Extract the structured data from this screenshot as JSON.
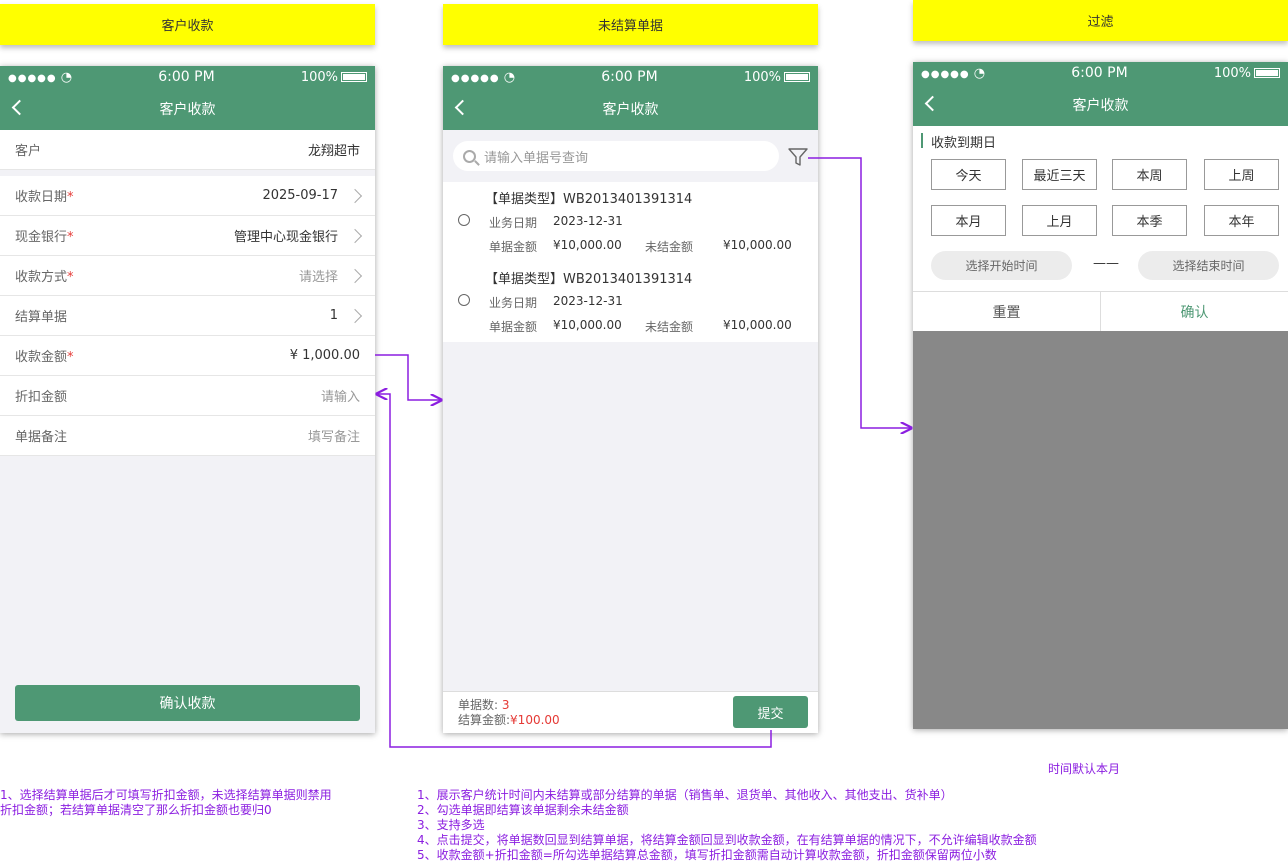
{
  "labels": {
    "screen1": "客户收款",
    "screen2": "未结算单据",
    "screen3": "过滤"
  },
  "statusbar": {
    "signal": "●●●●●",
    "time": "6:00 PM",
    "battery": "100%"
  },
  "screen1": {
    "title": "客户收款",
    "rows": [
      {
        "label": "客户",
        "value": "龙翔超市"
      },
      {
        "label": "收款日期",
        "value": "2025-09-17"
      },
      {
        "label": "现金银行",
        "value": "管理中心现金银行"
      },
      {
        "label": "收款方式",
        "value": "请选择"
      },
      {
        "label": "结算单据",
        "value": "1"
      },
      {
        "label": "收款金额",
        "value": "¥ 1,000.00"
      },
      {
        "label": "折扣金额",
        "value": "请输入"
      },
      {
        "label": "单据备注",
        "value": "填写备注"
      }
    ],
    "required_mark": "*",
    "confirm_label": "确认收款"
  },
  "screen2": {
    "title": "客户收款",
    "search_placeholder": "请输入单据号查询",
    "bills": [
      {
        "title": "【单据类型】WB2013401391314",
        "date_label": "业务日期",
        "date": "2023-12-31",
        "amount_label": "单据金额",
        "amount": "¥10,000.00",
        "unsettled_label": "未结金额",
        "unsettled": "¥10,000.00"
      },
      {
        "title": "【单据类型】WB2013401391314",
        "date_label": "业务日期",
        "date": "2023-12-31",
        "amount_label": "单据金额",
        "amount": "¥10,000.00",
        "unsettled_label": "未结金额",
        "unsettled": "¥10,000.00"
      }
    ],
    "footer": {
      "count_label": "单据数:",
      "count": "3",
      "total_label": "结算金额:",
      "total": "¥100.00",
      "submit_label": "提交"
    }
  },
  "screen3": {
    "title": "客户收款",
    "section": "收款到期日",
    "chips": [
      "今天",
      "最近三天",
      "本周",
      "上周",
      "本月",
      "上月",
      "本季",
      "本年"
    ],
    "start_placeholder": "选择开始时间",
    "dash": "——",
    "end_placeholder": "选择结束时间",
    "reset_label": "重置",
    "confirm_label": "确认"
  },
  "annotations": {
    "screen3_note": "时间默认本月",
    "screen1_note": [
      "1、选择结算单据后才可填写折扣金额，未选择结算单据则禁用",
      "折扣金额；若结算单据清空了那么折扣金额也要归0"
    ],
    "screen2_note": [
      "1、展示客户统计时间内未结算或部分结算的单据（销售单、退货单、其他收入、其他支出、货补单）",
      "2、勾选单据即结算该单据剩余未结金额",
      "3、支持多选",
      "4、点击提交，将单据数回显到结算单据，将结算金额回显到收款金额，在有结算单据的情况下，不允许编辑收款金额",
      "5、收款金额+折扣金额=所勾选单据结算总金额，填写折扣金额需自动计算收款金额，折扣金额保留两位小数"
    ]
  },
  "colors": {
    "brand_green": "#4e9874",
    "label_yellow": "#ffff00",
    "arrow_purple": "#8b1ee0",
    "required_red": "#e53935",
    "overlay_gray": "#888888"
  }
}
